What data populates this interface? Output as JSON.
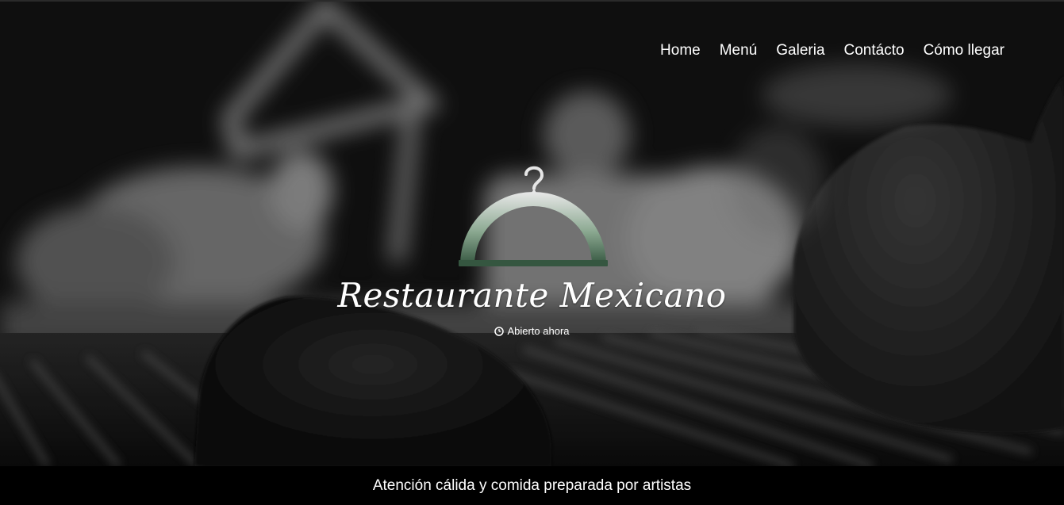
{
  "nav": {
    "items": [
      {
        "label": "Home"
      },
      {
        "label": "Menú"
      },
      {
        "label": "Galeria"
      },
      {
        "label": "Contácto"
      },
      {
        "label": "Cómo llegar"
      }
    ]
  },
  "hero": {
    "logo_icon": "food-cloche-icon",
    "logo_color": "#4a6b55",
    "title": "Restaurante Mexicano",
    "status_icon": "clock-icon",
    "status_text": "Abierto ahora"
  },
  "footer": {
    "tagline": "Atención cálida y comida preparada por artistas"
  }
}
